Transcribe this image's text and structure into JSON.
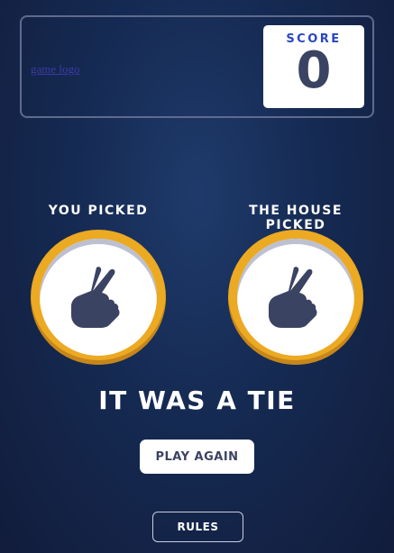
{
  "header": {
    "logo_alt": "game logo",
    "score_label": "SCORE",
    "score_value": "0"
  },
  "picks": {
    "you_label": "YOU PICKED",
    "you_choice_icon": "scissors-hand-icon",
    "house_label": "THE HOUSE PICKED",
    "house_choice_icon": "scissors-hand-icon",
    "token_color": "#eca922"
  },
  "result": {
    "text": "IT WAS A TIE"
  },
  "buttons": {
    "play_again": "PLAY AGAIN",
    "rules": "RULES"
  },
  "colors": {
    "background": "#1f3a6b",
    "score_label": "#2a46c0",
    "dark_text": "#3b4363"
  }
}
